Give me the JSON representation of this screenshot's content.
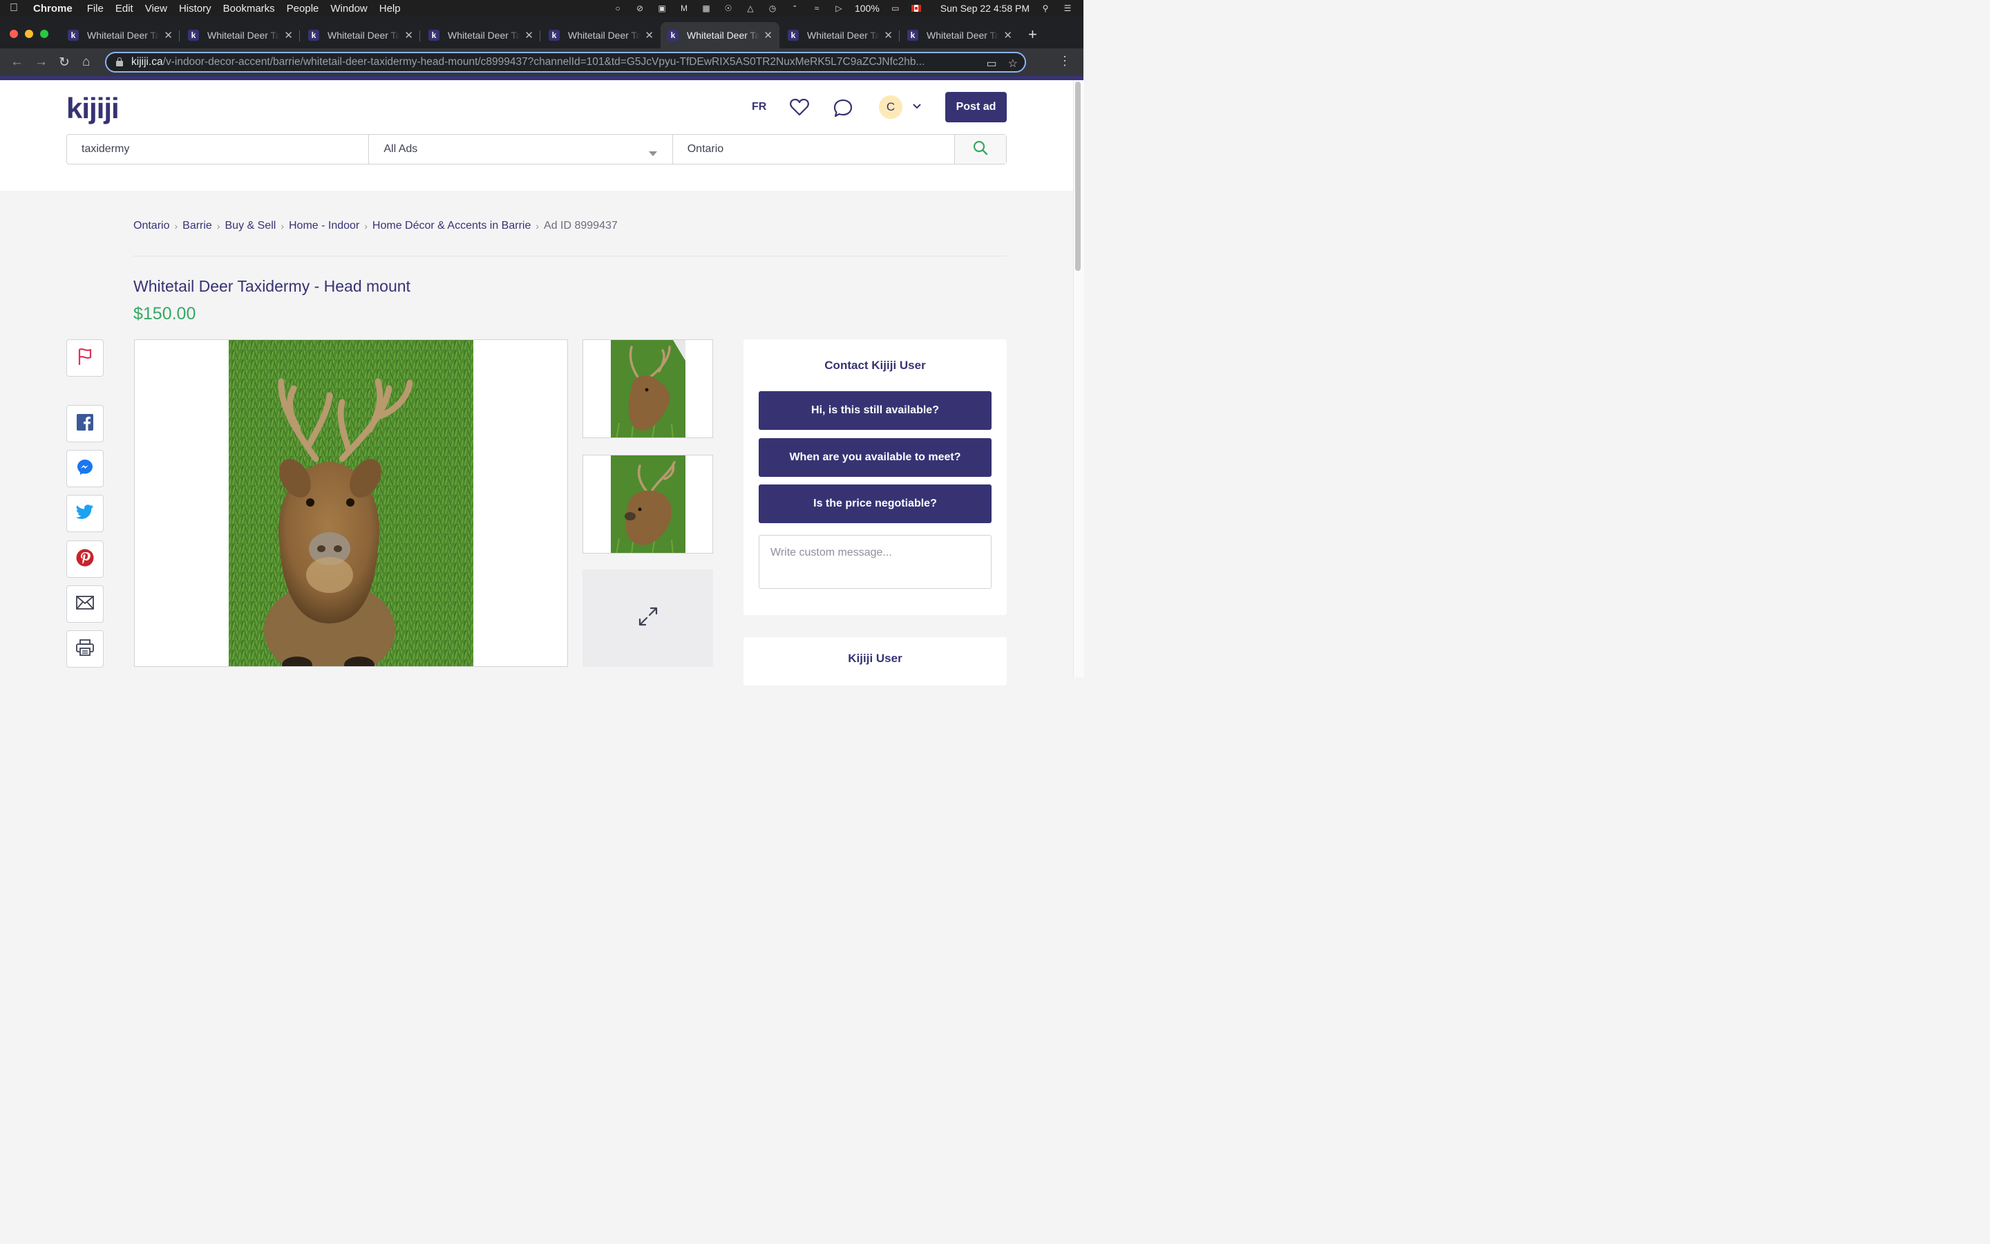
{
  "menubar": {
    "app": "Chrome",
    "items": [
      "File",
      "Edit",
      "View",
      "History",
      "Bookmarks",
      "People",
      "Window",
      "Help"
    ],
    "battery": "100%",
    "datetime": "Sun Sep 22  4:58 PM"
  },
  "tabs": [
    {
      "title": "Whitetail Deer Taxidermy - Head mount",
      "active": false
    },
    {
      "title": "Whitetail Deer Taxidermy - Head mount",
      "active": false
    },
    {
      "title": "Whitetail Deer Taxidermy - Head mount",
      "active": false
    },
    {
      "title": "Whitetail Deer Taxidermy - Head mount",
      "active": false
    },
    {
      "title": "Whitetail Deer Taxidermy - Head mount",
      "active": false
    },
    {
      "title": "Whitetail Deer Taxidermy - Head mount",
      "active": true
    },
    {
      "title": "Whitetail Deer Taxidermy - Head mount",
      "active": false
    },
    {
      "title": "Whitetail Deer Taxidermy - Head mount",
      "active": false
    }
  ],
  "tab_favicon": "k",
  "address": {
    "host": "kijiji.ca",
    "path": "/v-indoor-decor-accent/barrie/whitetail-deer-taxidermy-head-mount/c8999437?channelId=101&td=G5JcVpyu-TfDEwRIX5AS0TR2NuxMeRK5L7C9aZCJNfc2hb..."
  },
  "header": {
    "logo": "kijiji",
    "lang": "FR",
    "avatar_initial": "C",
    "post_ad": "Post ad"
  },
  "search": {
    "query": "taxidermy",
    "category": "All Ads",
    "location": "Ontario"
  },
  "breadcrumb": {
    "items": [
      "Ontario",
      "Barrie",
      "Buy & Sell",
      "Home - Indoor",
      "Home Décor & Accents in Barrie"
    ],
    "ad_id": "Ad ID 8999437"
  },
  "ad": {
    "title": "Whitetail Deer Taxidermy - Head mount",
    "price": "$150.00"
  },
  "contact": {
    "title": "Contact Kijiji User",
    "quick_replies": [
      "Hi, is this still available?",
      "When are you available to meet?",
      "Is the price negotiable?"
    ],
    "message_placeholder": "Write custom message..."
  },
  "seller": {
    "name": "Kijiji User"
  },
  "colors": {
    "brand": "#373373",
    "price": "#37a864",
    "flag": "#e4315b",
    "facebook": "#3b5998",
    "messenger": "#1877f2",
    "twitter": "#1da1f2",
    "pinterest": "#c8232c"
  }
}
